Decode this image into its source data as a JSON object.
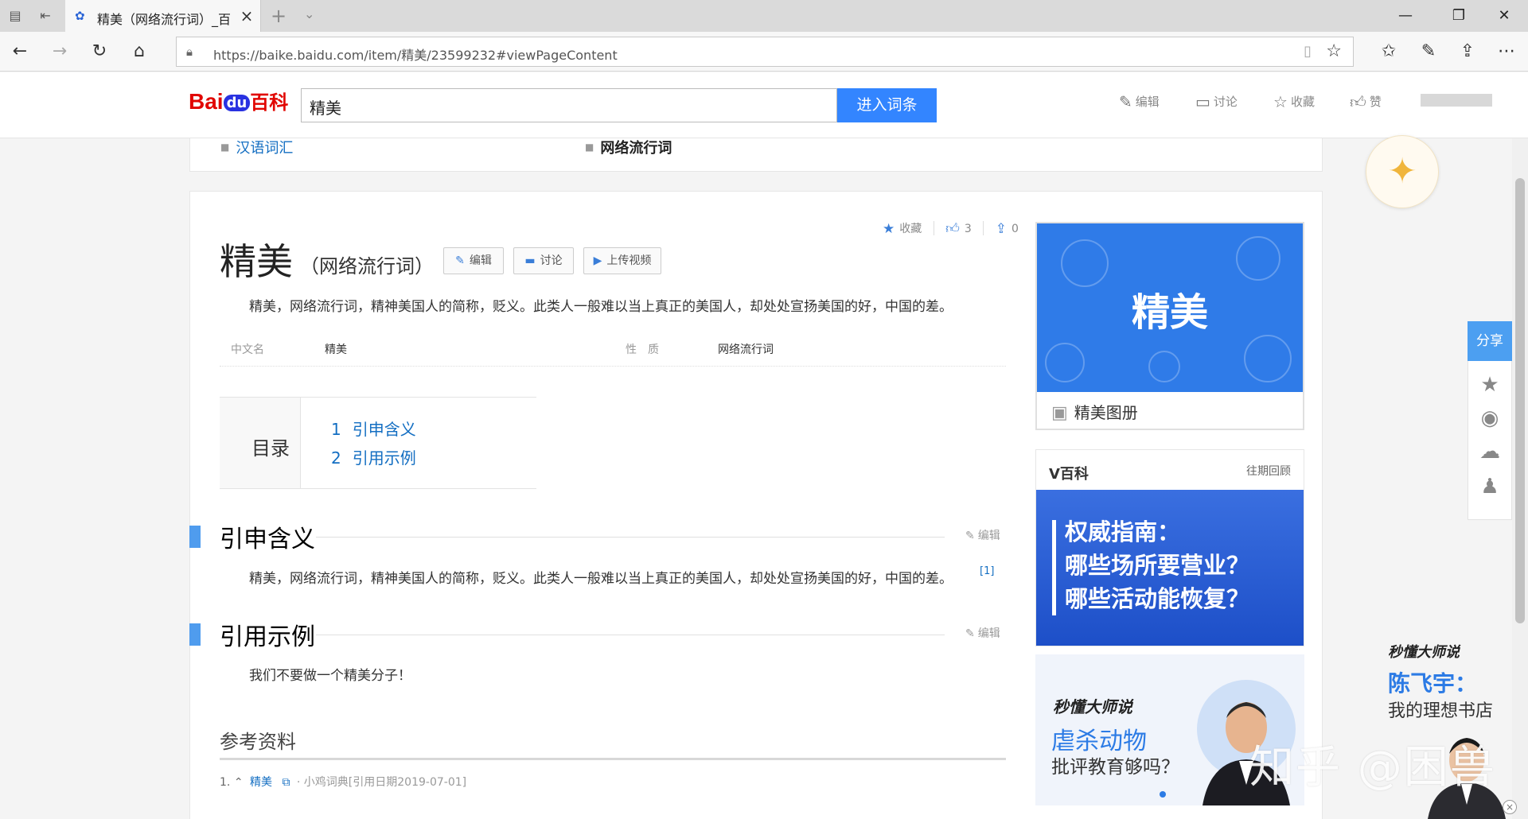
{
  "browser": {
    "tab_title": "精美（网络流行词）_百",
    "url": "https://baike.baidu.com/item/精美/23599232#viewPageContent",
    "minimize": "—",
    "maximize": "❐",
    "close": "✕"
  },
  "header": {
    "logo_bai": "Bai",
    "logo_du": "du",
    "logo_baike": "百科",
    "search_value": "精美",
    "search_button": "进入词条",
    "tools": [
      "编辑",
      "讨论",
      "收藏",
      "赞"
    ]
  },
  "related": {
    "item1": "汉语词汇",
    "item2": "网络流行词"
  },
  "article": {
    "title": "精美",
    "subtitle": "（网络流行词）",
    "actions": {
      "edit": "编辑",
      "discuss": "讨论",
      "upload_video": "上传视频"
    },
    "meta": {
      "collect": "收藏",
      "likes": "3",
      "shares": "0"
    },
    "summary": "精美，网络流行词，精神美国人的简称，贬义。此类人一般难以当上真正的美国人，却处处宣扬美国的好，中国的差。",
    "basic_info": [
      {
        "name": "中文名",
        "value": "精美"
      },
      {
        "name": "性　质",
        "value": "网络流行词"
      }
    ],
    "toc": {
      "title": "目录",
      "items": [
        {
          "num": "1",
          "label": "引申含义"
        },
        {
          "num": "2",
          "label": "引用示例"
        }
      ]
    },
    "sections": [
      {
        "title": "引申含义",
        "edit": "编辑",
        "text": "精美，网络流行词，精神美国人的简称，贬义。此类人一般难以当上真正的美国人，却处处宣扬美国的好，中国的差。",
        "cite": "[1]"
      },
      {
        "title": "引用示例",
        "edit": "编辑",
        "text": "我们不要做一个精美分子！"
      }
    ],
    "references": {
      "title": "参考资料",
      "items": [
        {
          "index": "1.",
          "link": "精美",
          "source": "· 小鸡词典[引用日期2019-07-01]"
        }
      ]
    }
  },
  "sidebar": {
    "album_word": "精美",
    "album_caption": "精美图册",
    "vbaike_title": "V百科",
    "vbaike_more": "往期回顾",
    "vbaike_lines": [
      "权威指南：",
      "哪些场所要营业？",
      "哪些活动能恢复？"
    ],
    "promo_brand": "秒懂大师说",
    "promo_line1": "虐杀动物",
    "promo_line2": "批评教育够吗？"
  },
  "share": {
    "label": "分享"
  },
  "float_ad": {
    "brand": "秒懂大师说",
    "name": "陈飞宇：",
    "sub": "我的理想书店"
  },
  "watermark": "知乎 @困兽",
  "colors": {
    "accent": "#3385ff",
    "link": "#136ec2",
    "logo_red": "#e10601",
    "section_bar": "#4f9cee"
  }
}
